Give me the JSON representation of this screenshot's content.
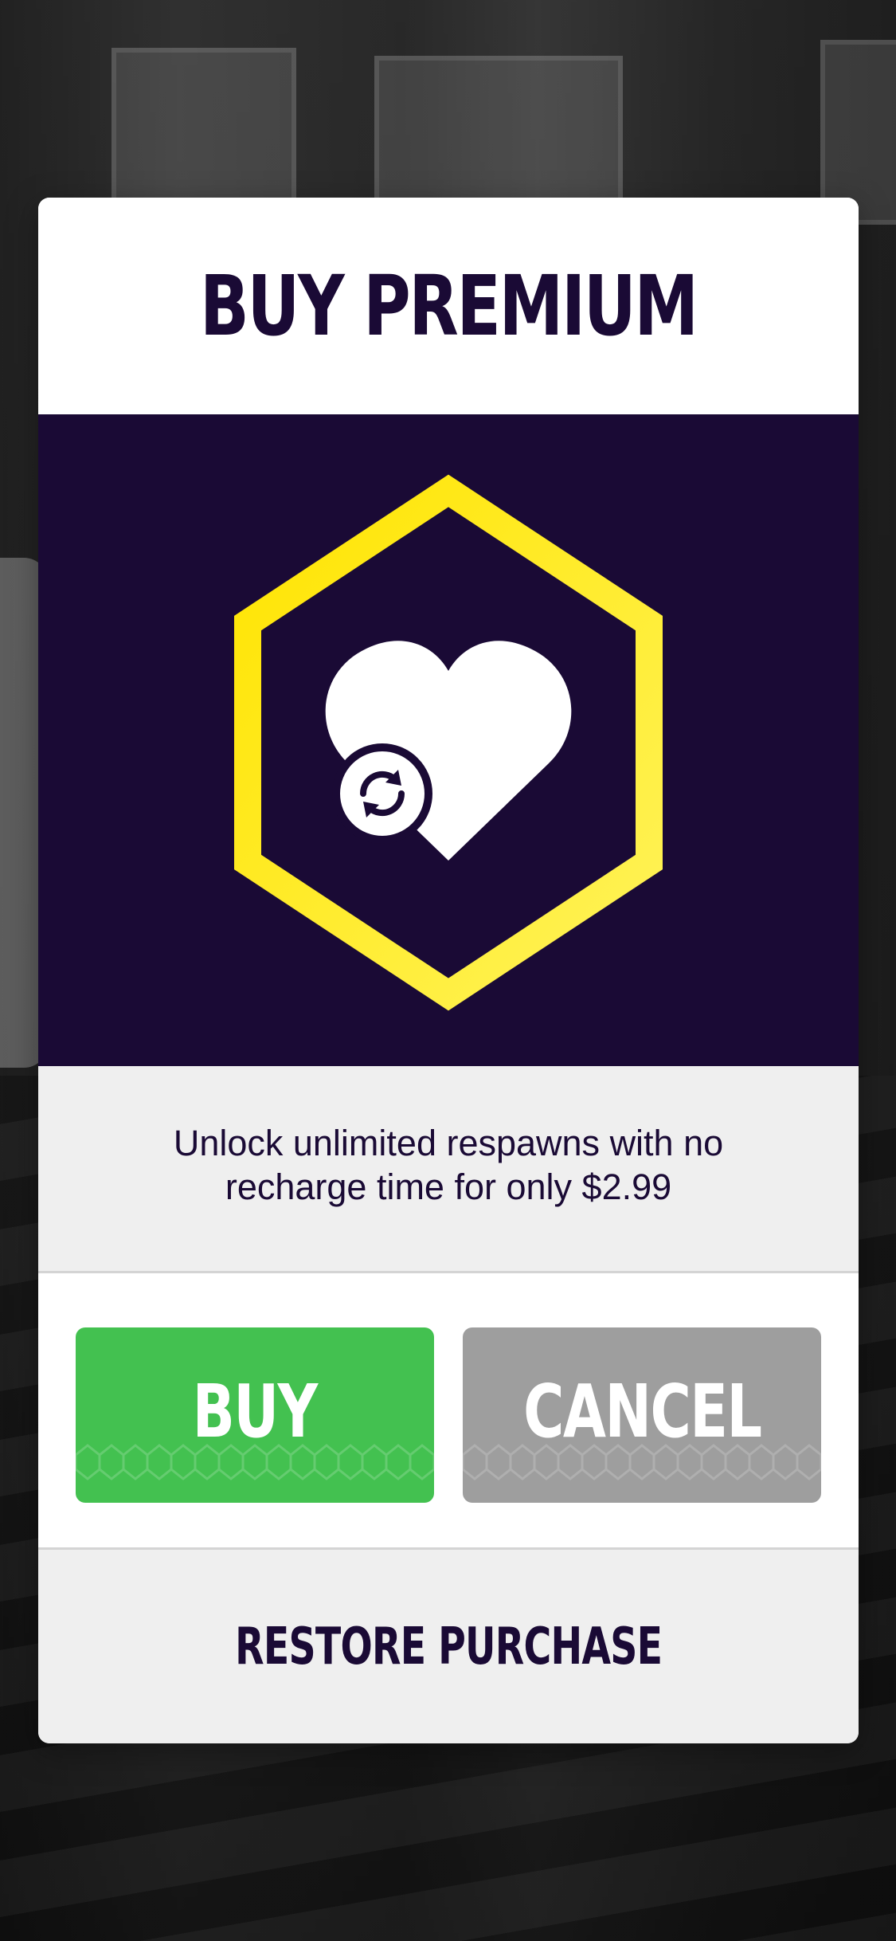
{
  "modal": {
    "title": "BUY PREMIUM",
    "description": "Unlock unlimited respawns with no recharge time for only $2.99",
    "hero_icon": "heart-with-refresh-icon",
    "buttons": {
      "buy_label": "BUY",
      "cancel_label": "CANCEL",
      "restore_label": "RESTORE PURCHASE"
    }
  },
  "colors": {
    "navy": "#1a0a35",
    "yellow": "#ffe81a",
    "buy_green": "#43c150",
    "cancel_gray": "#9e9e9e",
    "panel_gray": "#efefef"
  }
}
